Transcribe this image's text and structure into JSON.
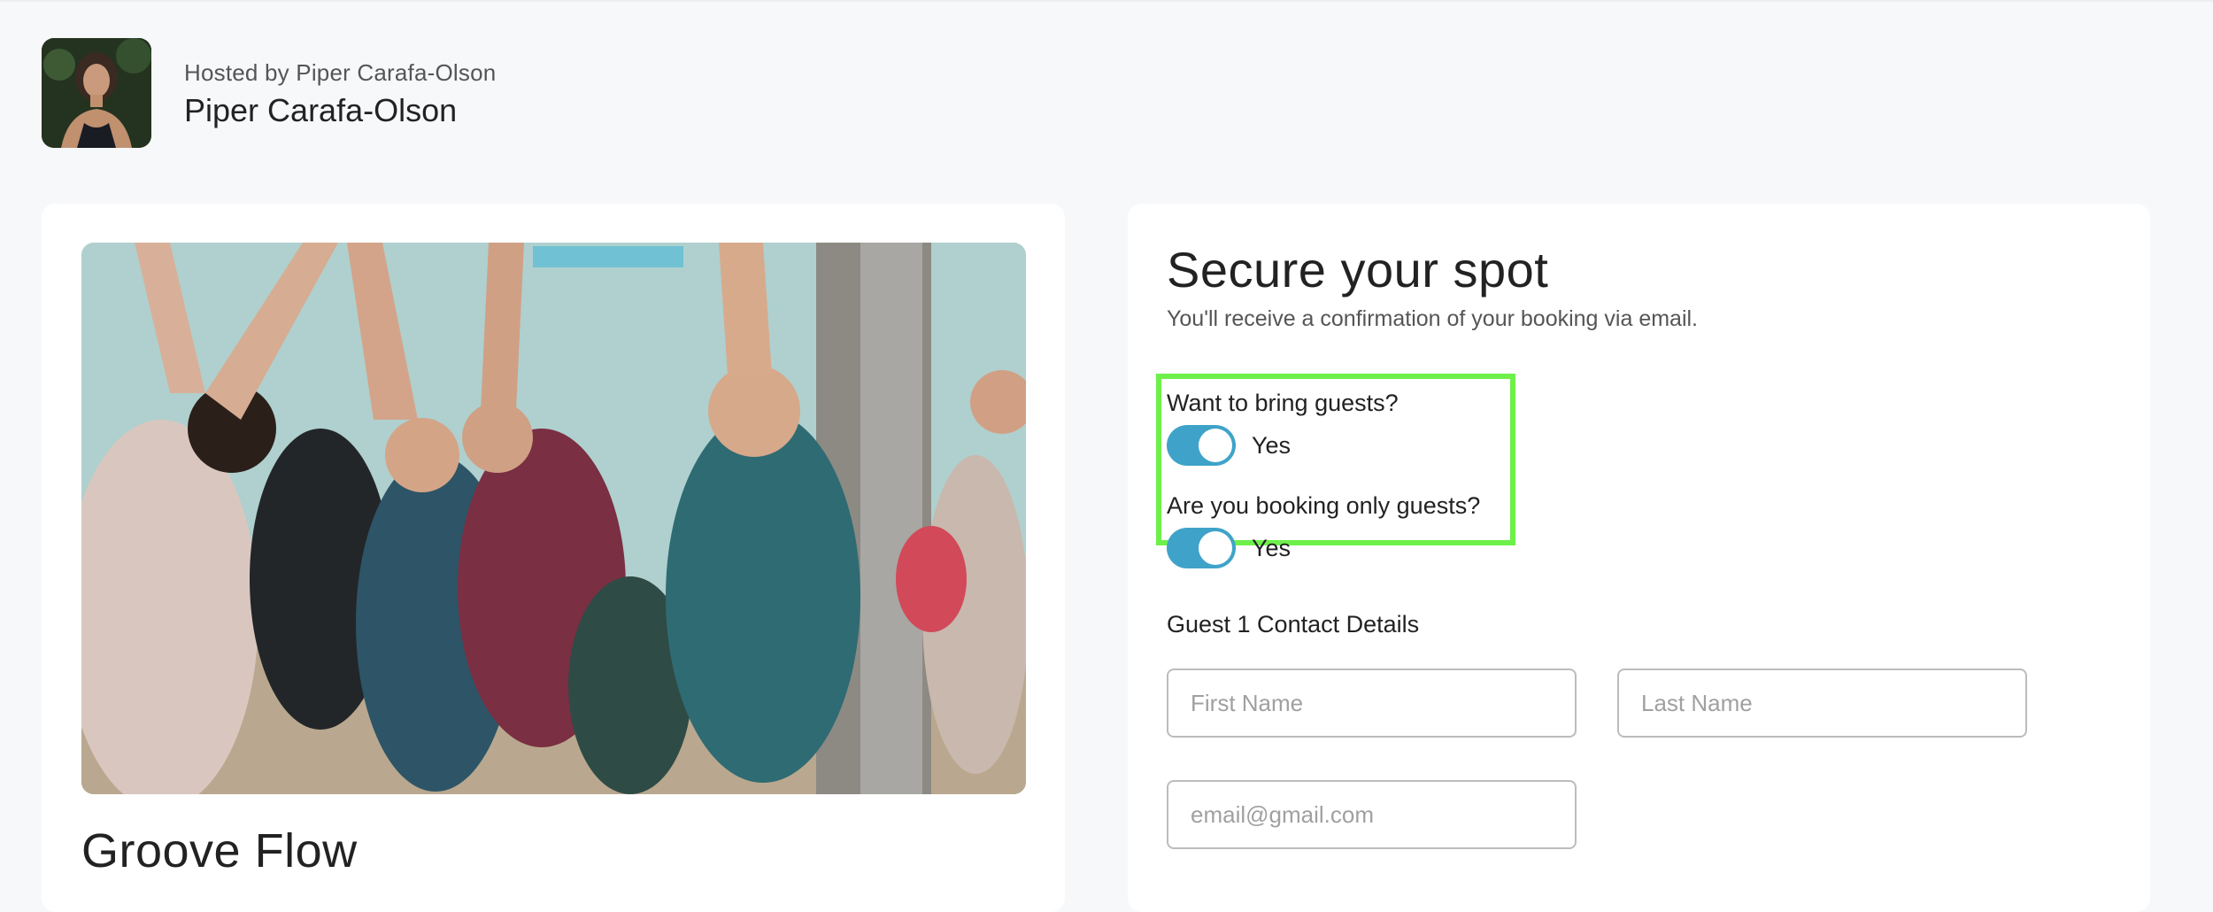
{
  "host": {
    "hosted_by": "Hosted by Piper Carafa-Olson",
    "name": "Piper Carafa-Olson"
  },
  "event": {
    "title": "Groove Flow"
  },
  "booking": {
    "title": "Secure your spot",
    "subtitle": "You'll receive a confirmation of your booking via email.",
    "bring_guests_question": "Want to bring guests?",
    "bring_guests_value": "Yes",
    "only_guests_question": "Are you booking only guests?",
    "only_guests_value": "Yes",
    "guest_section": "Guest 1 Contact Details",
    "first_name_placeholder": "First Name",
    "last_name_placeholder": "Last Name",
    "email_placeholder": "email@gmail.com"
  },
  "colors": {
    "toggle_on": "#3fa3c9",
    "highlight": "#6ef04a",
    "background": "#f7f8fa"
  },
  "icons": {
    "avatar": "host-avatar-photo",
    "hero": "yoga-class-photo"
  }
}
